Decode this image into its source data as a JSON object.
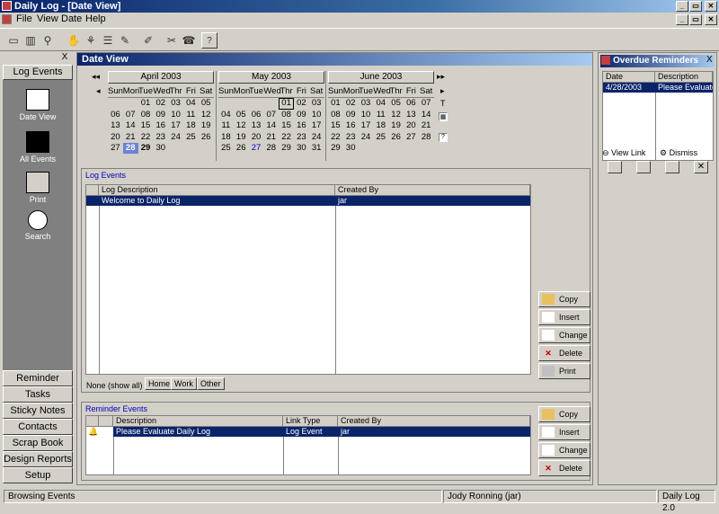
{
  "window": {
    "title": "Daily Log - [Date View]",
    "controls": [
      "_",
      "▭",
      "✕"
    ],
    "child_controls": [
      "_",
      "▭",
      "✕"
    ]
  },
  "menu": [
    "File",
    "View",
    "Date",
    "Help"
  ],
  "sidebar": {
    "top_button": "Log Events",
    "items": [
      {
        "label": "Date View"
      },
      {
        "label": "All Events"
      },
      {
        "label": "Print"
      },
      {
        "label": "Search"
      }
    ],
    "nav": [
      "Reminder",
      "Tasks",
      "Sticky Notes",
      "Contacts",
      "Scrap Book",
      "Design Reports",
      "Setup"
    ],
    "close": "X"
  },
  "date_view": {
    "title": "Date View",
    "nav_prev": "◂◂",
    "nav_next": "▸▸",
    "side_marks": [
      "◂",
      "▸",
      "T"
    ],
    "months": [
      {
        "name": "April  2003",
        "dow": [
          "Sun",
          "Mon",
          "Tue",
          "Wed",
          "Thr",
          "Fri",
          "Sat"
        ],
        "days": [
          "",
          "",
          "01",
          "02",
          "03",
          "04",
          "05",
          "06",
          "07",
          "08",
          "09",
          "10",
          "11",
          "12",
          "13",
          "14",
          "15",
          "16",
          "17",
          "18",
          "19",
          "20",
          "21",
          "22",
          "23",
          "24",
          "25",
          "26",
          "27",
          "28",
          "29",
          "30",
          "",
          "",
          ""
        ]
      },
      {
        "name": "May  2003",
        "dow": [
          "Sun",
          "Mon",
          "Tue",
          "Wed",
          "Thr",
          "Fri",
          "Sat"
        ],
        "days": [
          "",
          "",
          "",
          "",
          "01",
          "02",
          "03",
          "04",
          "05",
          "06",
          "07",
          "08",
          "09",
          "10",
          "11",
          "12",
          "13",
          "14",
          "15",
          "16",
          "17",
          "18",
          "19",
          "20",
          "21",
          "22",
          "23",
          "24",
          "25",
          "26",
          "27",
          "28",
          "29",
          "30",
          "31"
        ]
      },
      {
        "name": "June  2003",
        "dow": [
          "Sun",
          "Mon",
          "Tue",
          "Wed",
          "Thr",
          "Fri",
          "Sat"
        ],
        "days": [
          "01",
          "02",
          "03",
          "04",
          "05",
          "06",
          "07",
          "08",
          "09",
          "10",
          "11",
          "12",
          "13",
          "14",
          "15",
          "16",
          "17",
          "18",
          "19",
          "20",
          "21",
          "22",
          "23",
          "24",
          "25",
          "26",
          "27",
          "28",
          "29",
          "30",
          "",
          "",
          "",
          "",
          ""
        ]
      }
    ]
  },
  "log_events": {
    "title": "Log Events",
    "columns": [
      "Log Description",
      "Created By"
    ],
    "rows": [
      {
        "desc": "Welcome to Daily Log",
        "by": "jar"
      }
    ],
    "buttons": [
      "Copy",
      "Insert",
      "Change",
      "Delete",
      "Print"
    ],
    "tabs": [
      "None (show all)",
      "Home",
      "Work",
      "Other"
    ]
  },
  "reminder_events": {
    "title": "Reminder Events",
    "columns": [
      "Description",
      "Link Type",
      "Created By"
    ],
    "rows": [
      {
        "desc": "Please Evaluate Daily Log",
        "link": "Log Event",
        "by": "jar"
      }
    ],
    "buttons": [
      "Copy",
      "Insert",
      "Change",
      "Delete"
    ]
  },
  "overdue": {
    "title": "Overdue Reminders",
    "close": "X",
    "columns": [
      "Date",
      "Description"
    ],
    "rows": [
      {
        "date": "4/28/2003",
        "desc": "Please Evaluate"
      }
    ],
    "view_link": "View Link",
    "dismiss": "Dismiss"
  },
  "status": {
    "left": "Browsing Events",
    "user": "Jody Ronning (jar)",
    "version": "Daily Log 2.0"
  },
  "colors": {
    "accent": "#0a246a",
    "selected_day": "#6a82d8",
    "link_day": "#0000c0"
  }
}
